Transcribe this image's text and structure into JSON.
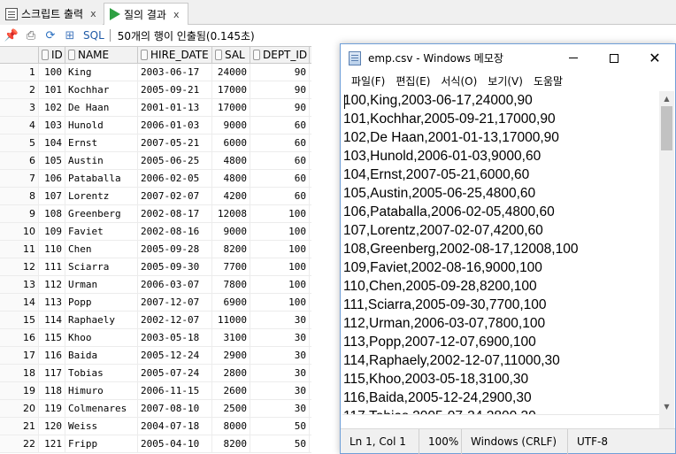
{
  "editor_tabs": [
    {
      "label": "스크립트 출력",
      "close": "x"
    },
    {
      "label": "질의 결과",
      "close": "x"
    }
  ],
  "result_toolbar": {
    "sql_label": "SQL",
    "status": "50개의 행이 인출됨(0.145초)"
  },
  "grid": {
    "headers": [
      "ID",
      "NAME",
      "HIRE_DATE",
      "SAL",
      "DEPT_ID"
    ],
    "rows": [
      [
        "1",
        "100",
        "King",
        "2003-06-17",
        "24000",
        "90"
      ],
      [
        "2",
        "101",
        "Kochhar",
        "2005-09-21",
        "17000",
        "90"
      ],
      [
        "3",
        "102",
        "De Haan",
        "2001-01-13",
        "17000",
        "90"
      ],
      [
        "4",
        "103",
        "Hunold",
        "2006-01-03",
        "9000",
        "60"
      ],
      [
        "5",
        "104",
        "Ernst",
        "2007-05-21",
        "6000",
        "60"
      ],
      [
        "6",
        "105",
        "Austin",
        "2005-06-25",
        "4800",
        "60"
      ],
      [
        "7",
        "106",
        "Pataballa",
        "2006-02-05",
        "4800",
        "60"
      ],
      [
        "8",
        "107",
        "Lorentz",
        "2007-02-07",
        "4200",
        "60"
      ],
      [
        "9",
        "108",
        "Greenberg",
        "2002-08-17",
        "12008",
        "100"
      ],
      [
        "10",
        "109",
        "Faviet",
        "2002-08-16",
        "9000",
        "100"
      ],
      [
        "11",
        "110",
        "Chen",
        "2005-09-28",
        "8200",
        "100"
      ],
      [
        "12",
        "111",
        "Sciarra",
        "2005-09-30",
        "7700",
        "100"
      ],
      [
        "13",
        "112",
        "Urman",
        "2006-03-07",
        "7800",
        "100"
      ],
      [
        "14",
        "113",
        "Popp",
        "2007-12-07",
        "6900",
        "100"
      ],
      [
        "15",
        "114",
        "Raphaely",
        "2002-12-07",
        "11000",
        "30"
      ],
      [
        "16",
        "115",
        "Khoo",
        "2003-05-18",
        "3100",
        "30"
      ],
      [
        "17",
        "116",
        "Baida",
        "2005-12-24",
        "2900",
        "30"
      ],
      [
        "18",
        "117",
        "Tobias",
        "2005-07-24",
        "2800",
        "30"
      ],
      [
        "19",
        "118",
        "Himuro",
        "2006-11-15",
        "2600",
        "30"
      ],
      [
        "20",
        "119",
        "Colmenares",
        "2007-08-10",
        "2500",
        "30"
      ],
      [
        "21",
        "120",
        "Weiss",
        "2004-07-18",
        "8000",
        "50"
      ],
      [
        "22",
        "121",
        "Fripp",
        "2005-04-10",
        "8200",
        "50"
      ]
    ]
  },
  "notepad": {
    "title": "emp.csv - Windows 메모장",
    "menu": [
      "파일(F)",
      "편집(E)",
      "서식(O)",
      "보기(V)",
      "도움말"
    ],
    "lines": [
      "100,King,2003-06-17,24000,90",
      "101,Kochhar,2005-09-21,17000,90",
      "102,De Haan,2001-01-13,17000,90",
      "103,Hunold,2006-01-03,9000,60",
      "104,Ernst,2007-05-21,6000,60",
      "105,Austin,2005-06-25,4800,60",
      "106,Pataballa,2006-02-05,4800,60",
      "107,Lorentz,2007-02-07,4200,60",
      "108,Greenberg,2002-08-17,12008,100",
      "109,Faviet,2002-08-16,9000,100",
      "110,Chen,2005-09-28,8200,100",
      "111,Sciarra,2005-09-30,7700,100",
      "112,Urman,2006-03-07,7800,100",
      "113,Popp,2007-12-07,6900,100",
      "114,Raphaely,2002-12-07,11000,30",
      "115,Khoo,2003-05-18,3100,30",
      "116,Baida,2005-12-24,2900,30",
      "117,Tobias,2005-07-24,2800,30"
    ],
    "status": {
      "position": "Ln 1, Col 1",
      "zoom": "100%",
      "line_ending": "Windows (CRLF)",
      "encoding": "UTF-8"
    }
  }
}
